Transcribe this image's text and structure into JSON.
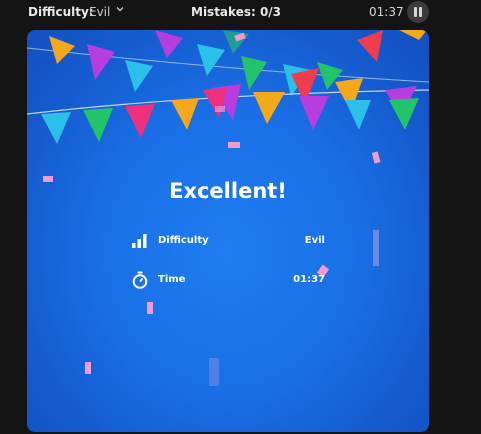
{
  "topbar": {
    "difficulty_label": "Difficulty:",
    "difficulty_value": "Evil",
    "mistakes": "Mistakes: 0/3",
    "timer": "01:37",
    "pause_icon": "pause-icon",
    "chevron_icon": "chevron-down-icon"
  },
  "result": {
    "title": "Excellent!",
    "stats": [
      {
        "label": "Difficulty",
        "value": "Evil",
        "icon": "bar-chart-icon"
      },
      {
        "label": "Time",
        "value": "01:37",
        "icon": "stopwatch-icon"
      }
    ]
  },
  "colors": {
    "background": "#141414",
    "card_blue": "#1a6fe6",
    "pennant_pink": "#f0307a",
    "pennant_purple": "#b83ce0",
    "pennant_yellow": "#f6a81c",
    "pennant_green": "#22c46a",
    "pennant_cyan": "#2bc0e8",
    "pennant_red": "#f03c4c",
    "confetti_pink": "#f39ad0"
  }
}
